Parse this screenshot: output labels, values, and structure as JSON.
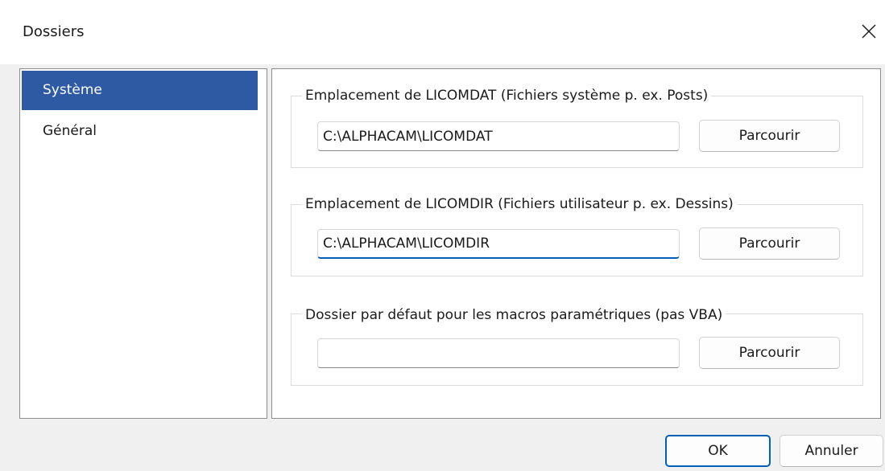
{
  "window": {
    "title": "Dossiers",
    "close_icon": "close-icon"
  },
  "nav": {
    "items": [
      {
        "label": "Système",
        "selected": true
      },
      {
        "label": "Général",
        "selected": false
      }
    ]
  },
  "groups": [
    {
      "legend": "Emplacement de LICOMDAT (Fichiers système p. ex. Posts)",
      "value": "C:\\ALPHACAM\\LICOMDAT",
      "placeholder": "",
      "focused": false,
      "browse_label": "Parcourir"
    },
    {
      "legend": "Emplacement de LICOMDIR (Fichiers utilisateur p. ex. Dessins)",
      "value": "C:\\ALPHACAM\\LICOMDIR",
      "placeholder": "",
      "focused": true,
      "browse_label": "Parcourir"
    },
    {
      "legend": "Dossier par défaut pour les macros paramétriques (pas VBA)",
      "value": "",
      "placeholder": "",
      "focused": false,
      "browse_label": "Parcourir"
    }
  ],
  "footer": {
    "ok_label": "OK",
    "cancel_label": "Annuler"
  },
  "colors": {
    "selection": "#2d5aa2",
    "focus_accent": "#005fb8"
  }
}
